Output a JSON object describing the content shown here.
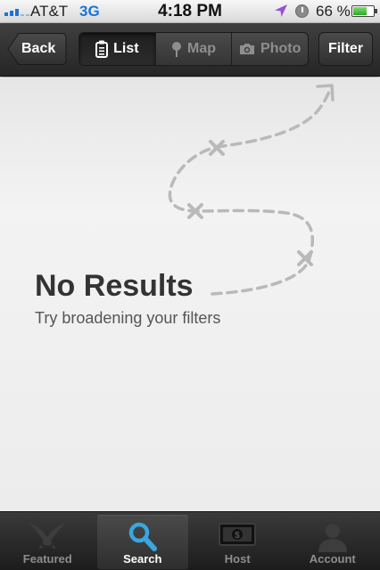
{
  "status_bar": {
    "carrier": "AT&T",
    "network": "3G",
    "time": "4:18 PM",
    "battery_percent": "66 %",
    "battery_level": 0.66,
    "icons": [
      "signal-icon",
      "location-arrow-icon",
      "clock-icon",
      "battery-icon"
    ]
  },
  "nav": {
    "back_label": "Back",
    "segments": [
      {
        "label": "List",
        "icon": "list-icon",
        "active": true
      },
      {
        "label": "Map",
        "icon": "map-pin-icon",
        "active": false
      },
      {
        "label": "Photo",
        "icon": "camera-icon",
        "active": false
      }
    ],
    "filter_label": "Filter"
  },
  "empty_state": {
    "title": "No Results",
    "subtitle": "Try broadening your filters",
    "illustration": "dashed-route-with-x-marks"
  },
  "tab_bar": {
    "tabs": [
      {
        "label": "Featured",
        "icon": "featured-icon",
        "active": false
      },
      {
        "label": "Search",
        "icon": "magnifier-icon",
        "active": true
      },
      {
        "label": "Host",
        "icon": "money-icon",
        "active": false
      },
      {
        "label": "Account",
        "icon": "person-icon",
        "active": false
      }
    ]
  },
  "colors": {
    "accent_blue": "#1a74d8",
    "search_icon": "#3aa6e0",
    "location_arrow": "#9b4fd6",
    "battery_green": "#3cb83a"
  }
}
